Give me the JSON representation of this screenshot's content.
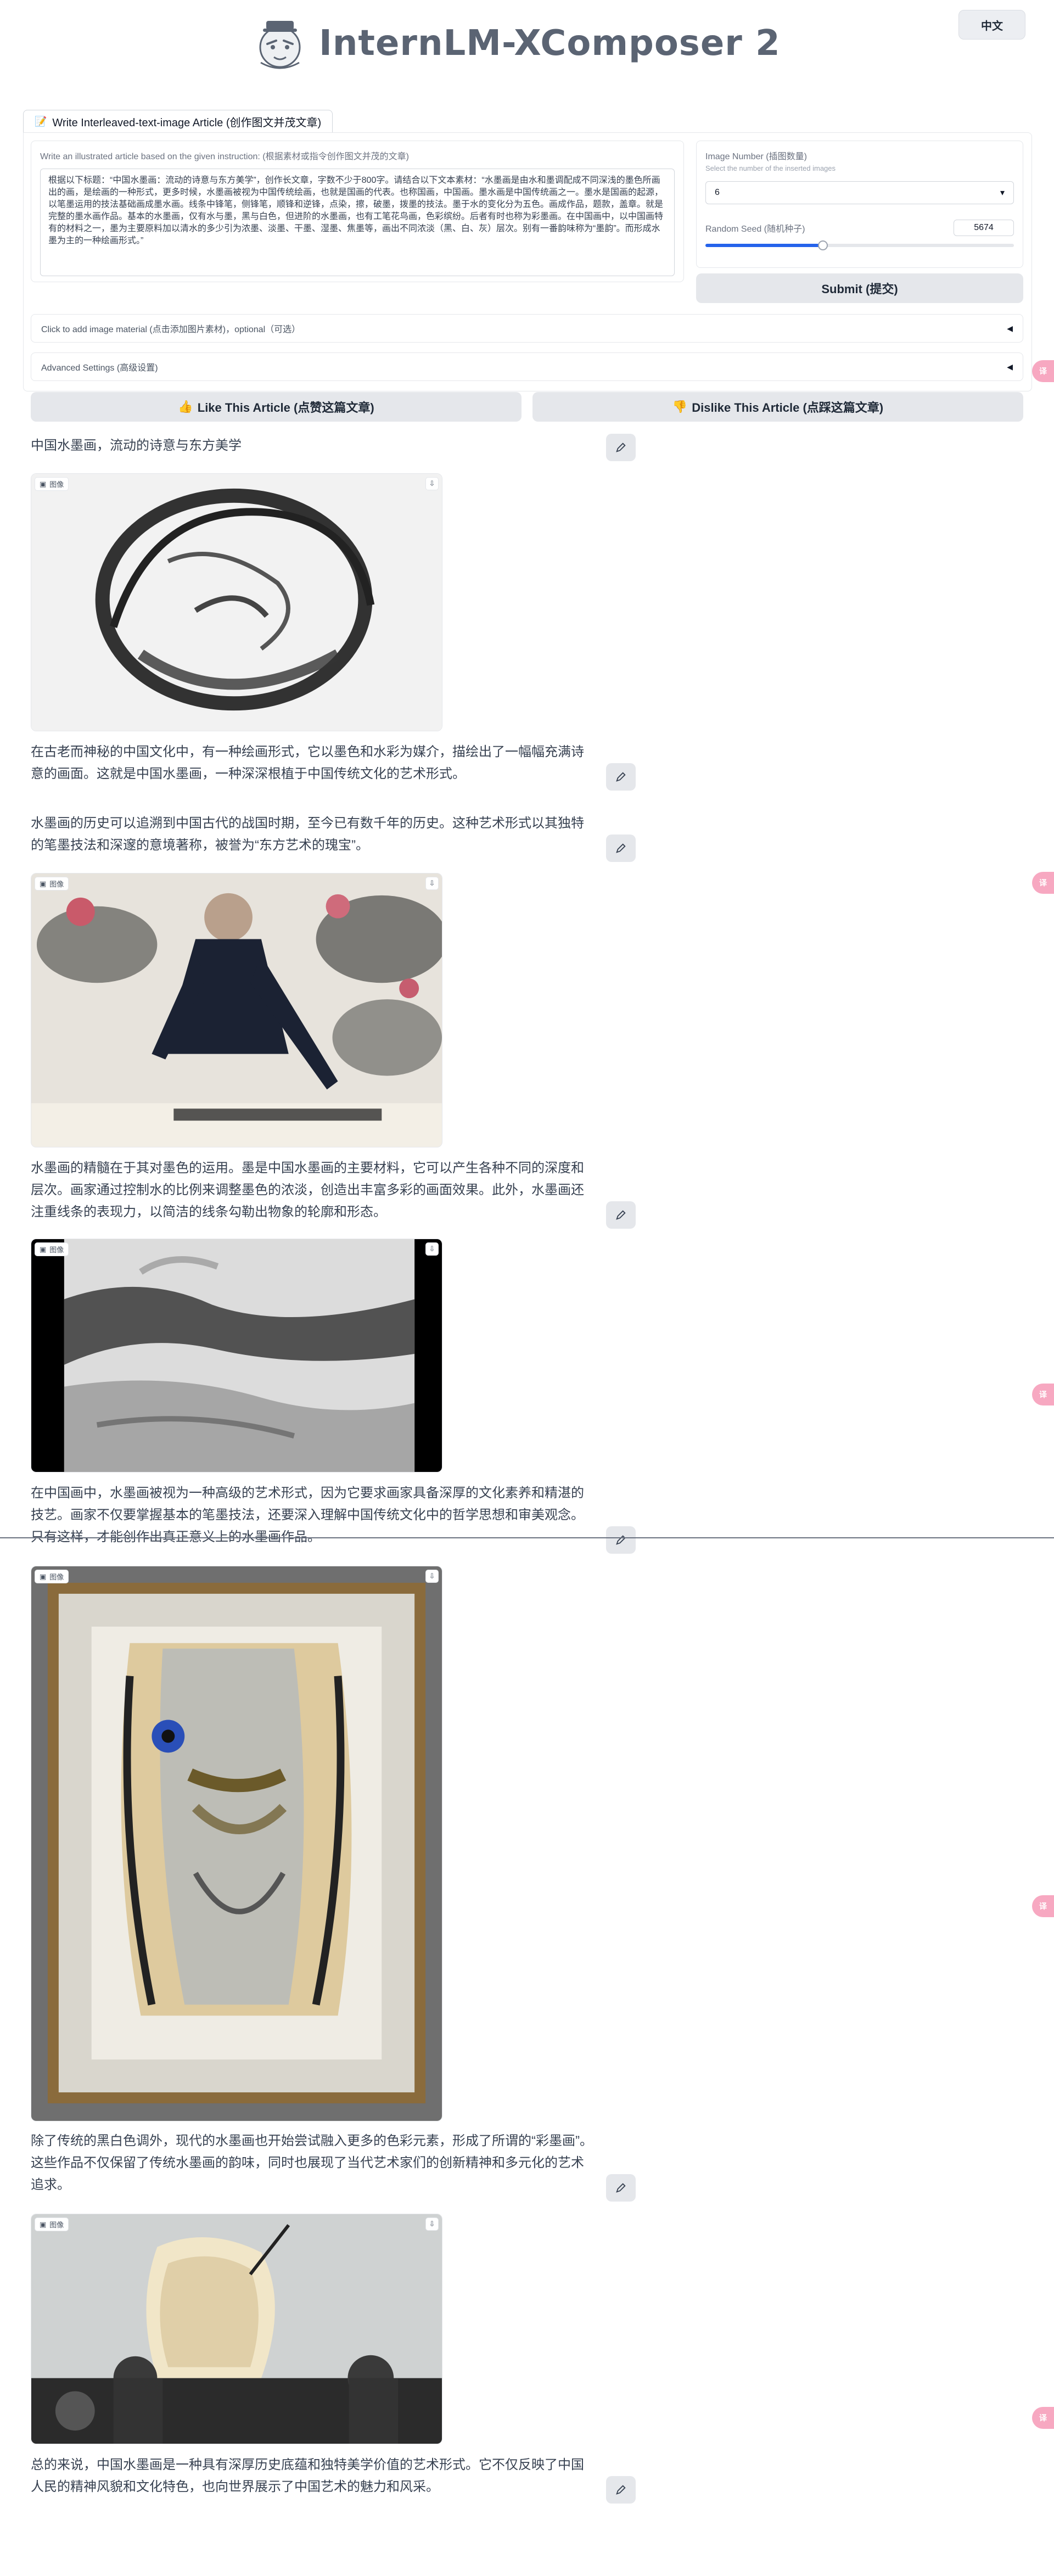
{
  "header": {
    "title": "InternLM-XComposer 2",
    "lang_button": "中文"
  },
  "tab": {
    "label": "Write Interleaved-text-image Article (创作图文并茂文章)"
  },
  "instruction": {
    "label": "Write an illustrated article based on the given instruction: (根据素材或指令创作图文并茂的文章)",
    "text": "根据以下标题：“中国水墨画：流动的诗意与东方美学”，创作长文章，字数不少于800字。请结合以下文本素材：“水墨画是由水和墨调配成不同深浅的墨色所画出的画，是绘画的一种形式，更多时候，水墨画被视为中国传统绘画，也就是国画的代表。也称国画，中国画。墨水画是中国传统画之一。墨水是国画的起源，以笔墨运用的技法基础画成墨水画。线条中锋笔，侧锋笔，顺锋和逆锋，点染，擦，破墨，拨墨的技法。墨于水的变化分为五色。画成作品，题款，盖章。就是完整的墨水画作品。基本的水墨画，仅有水与墨，黑与白色，但进阶的水墨画，也有工笔花鸟画，色彩缤纷。后者有时也称为彩墨画。在中国画中，以中国画特有的材料之一，墨为主要原料加以清水的多少引为浓墨、淡墨、干墨、湿墨、焦墨等，画出不同浓淡（黑、白、灰）层次。别有一番韵味称为“墨韵”。而形成水墨为主的一种绘画形式。”"
  },
  "settings": {
    "image_number_label": "Image Number (插图数量)",
    "image_number_info": "Select the number of the inserted images",
    "image_number_value": "6",
    "seed_label": "Random Seed (随机种子)",
    "seed_value": "5674",
    "seed_fraction": 0.38
  },
  "buttons": {
    "submit": "Submit (提交)",
    "like": "Like This Article (点赞这篇文章)",
    "dislike": "Dislike This Article (点踩这篇文章)"
  },
  "accordions": {
    "image_material": "Click to add image material (点击添加图片素材)，optional（可选）",
    "advanced": "Advanced Settings (高级设置)"
  },
  "image_tag_label": "图像",
  "side_float_label": "译",
  "article": {
    "title": "中国水墨画，流动的诗意与东方美学",
    "p1": "在古老而神秘的中国文化中，有一种绘画形式，它以墨色和水彩为媒介，描绘出了一幅幅充满诗意的画面。这就是中国水墨画，一种深深根植于中国传统文化的艺术形式。",
    "p2": "水墨画的历史可以追溯到中国古代的战国时期，至今已有数千年的历史。这种艺术形式以其独特的笔墨技法和深邃的意境著称，被誉为“东方艺术的瑰宝”。",
    "p3": "水墨画的精髓在于其对墨色的运用。墨是中国水墨画的主要材料，它可以产生各种不同的深度和层次。画家通过控制水的比例来调整墨色的浓淡，创造出丰富多彩的画面效果。此外，水墨画还注重线条的表现力，以简洁的线条勾勒出物象的轮廓和形态。",
    "p4": "在中国画中，水墨画被视为一种高级的艺术形式，因为它要求画家具备深厚的文化素养和精湛的技艺。画家不仅要掌握基本的笔墨技法，还要深入理解中国传统文化中的哲学思想和审美观念。只有这样，才能创作出真正意义上的水墨画作品。",
    "p5": "除了传统的黑白色调外，现代的水墨画也开始尝试融入更多的色彩元素，形成了所谓的“彩墨画”。这些作品不仅保留了传统水墨画的韵味，同时也展现了当代艺术家们的创新精神和多元化的艺术追求。",
    "p6": "总的来说，中国水墨画是一种具有深厚历史底蕴和独特美学价值的艺术形式。它不仅反映了中国人民的精神风貌和文化特色，也向世界展示了中国艺术的魅力和风采。"
  }
}
